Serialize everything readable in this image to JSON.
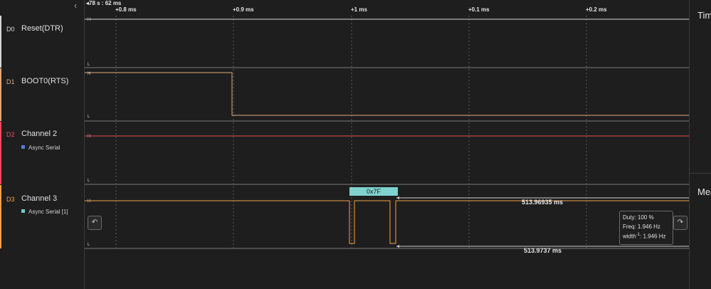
{
  "header": {
    "ruler_time": "78 s : 62 ms",
    "tick_labels": [
      "+0.8 ms",
      "+0.9 ms",
      "+1 ms",
      "+0.1 ms",
      "+0.2 ms"
    ]
  },
  "channels": [
    {
      "id": "D0",
      "name": "Reset(DTR)",
      "color": "#d8d8d8",
      "high": "H",
      "low": "L"
    },
    {
      "id": "D1",
      "name": "BOOT0(RTS)",
      "color": "#e0a978",
      "high": "H",
      "low": "L"
    },
    {
      "id": "D2",
      "name": "Channel 2",
      "color": "#ef4a59",
      "analyzer": "Async Serial",
      "analyzer_color": "#4f7fd8",
      "high": "H",
      "low": "L"
    },
    {
      "id": "D3",
      "name": "Channel 3",
      "color": "#f0a14a",
      "analyzer": "Async Serial [1]",
      "analyzer_color": "#6cc9c9",
      "high": "H",
      "low": "L"
    }
  ],
  "decode": {
    "value": "0x7F",
    "color": "#7fd2cf"
  },
  "measurements": {
    "upper_width": "513.96935 ms",
    "lower_width": "513.9737 ms"
  },
  "tooltip": {
    "duty": "Duty: 100 %",
    "freq": "Freq: 1.946 Hz",
    "width_prefix": "width",
    "width_sup": "-1",
    "width_value": ": 1.946 Hz"
  },
  "nav": {
    "prev_icon": "prev-edge-icon",
    "next_icon": "next-edge-icon",
    "prev_glyph": "↶",
    "next_glyph": "↷"
  },
  "right_panel": {
    "top_title": "Timing",
    "bottom_title": "Measurements"
  }
}
